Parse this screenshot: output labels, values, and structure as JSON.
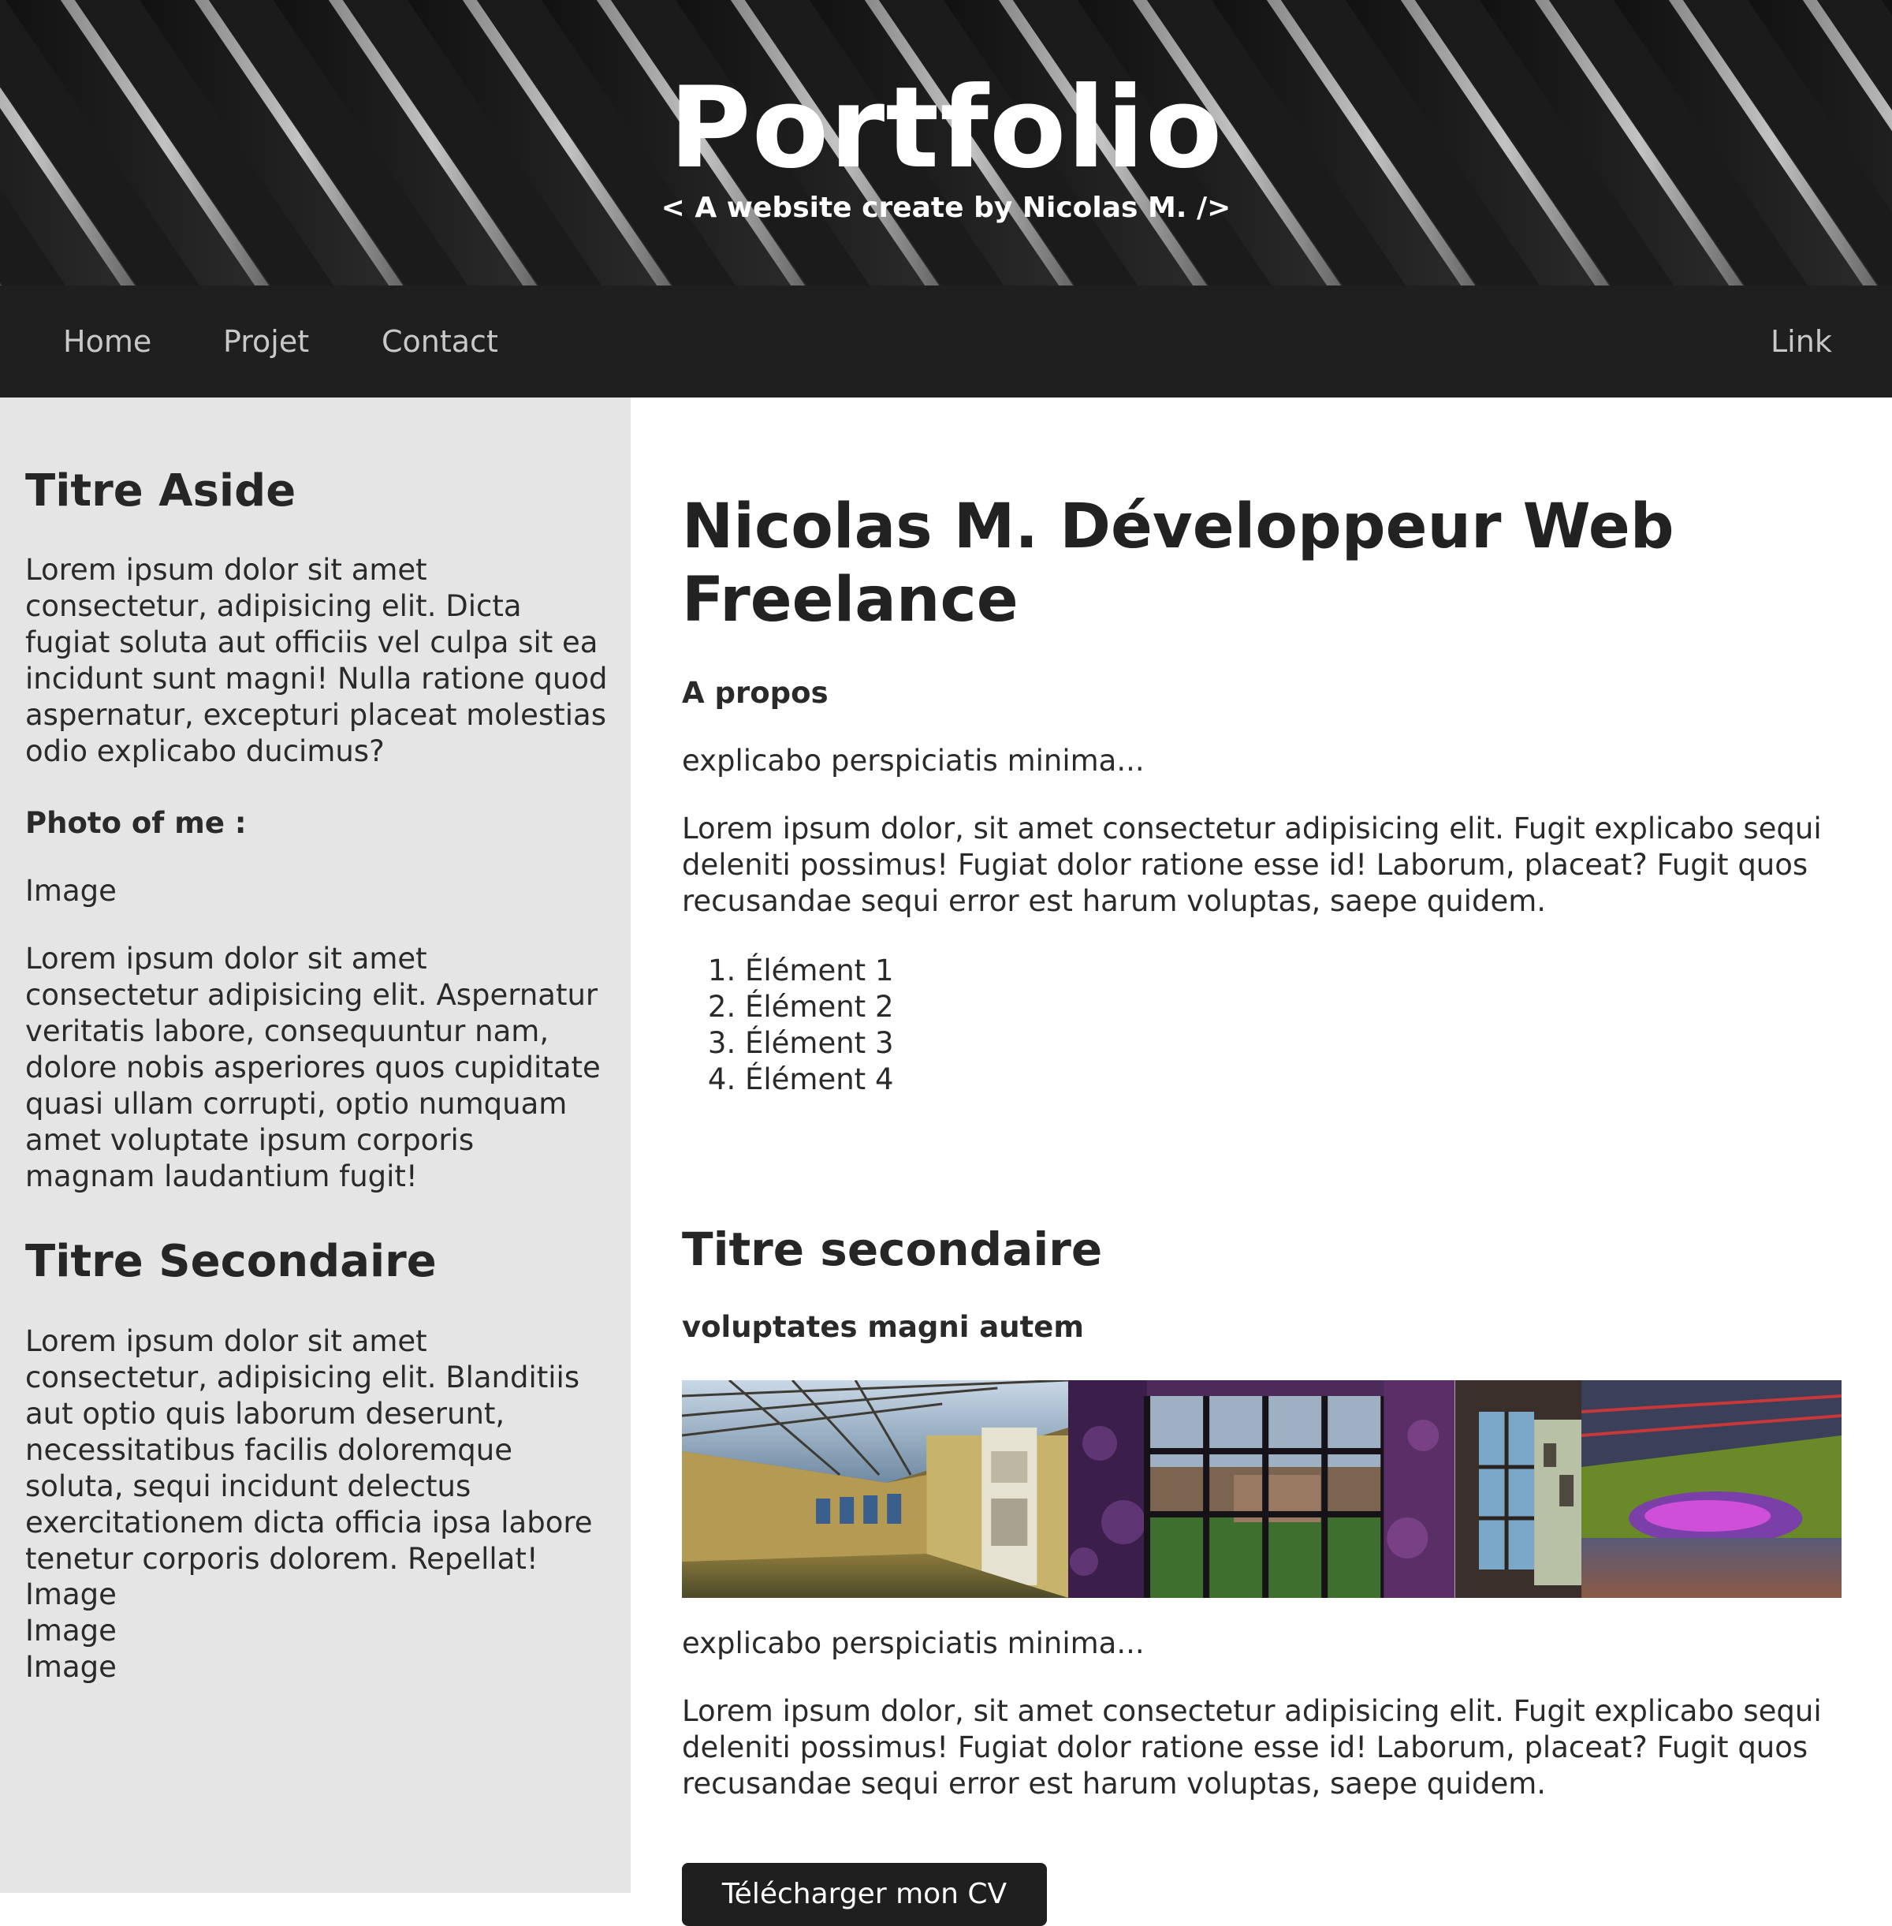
{
  "header": {
    "title": "Portfolio",
    "subtitle": "< A website create by Nicolas M. />"
  },
  "nav": {
    "items": [
      {
        "label": "Home"
      },
      {
        "label": "Projet"
      },
      {
        "label": "Contact"
      }
    ],
    "right_link": "Link"
  },
  "aside": {
    "title1": "Titre Aside",
    "para1": "Lorem ipsum dolor sit amet consectetur, adipisicing elit. Dicta fugiat soluta aut officiis vel culpa sit ea incidunt sunt magni! Nulla ratione quod aspernatur, excepturi placeat molestias odio explicabo ducimus?",
    "photo_label": "Photo of me :",
    "image_label": "Image",
    "para2": "Lorem ipsum dolor sit amet consectetur adipisicing elit. Aspernatur veritatis labore, consequuntur nam, dolore nobis asperiores quos cupiditate quasi ullam corrupti, optio numquam amet voluptate ipsum corporis magnam laudantium fugit!",
    "title2": "Titre Secondaire",
    "para3": "Lorem ipsum dolor sit amet consectetur, adipisicing elit. Blanditiis aut optio quis laborum deserunt, necessitatibus facilis doloremque soluta, sequi incidunt delectus exercitationem dicta officia ipsa labore tenetur corporis dolorem. Repellat!",
    "images": [
      "Image",
      "Image",
      "Image"
    ]
  },
  "main": {
    "title": "Nicolas M. Développeur Web Freelance",
    "about_heading": "A propos",
    "intro": "explicabo perspiciatis minima...",
    "paragraph": "Lorem ipsum dolor, sit amet consectetur adipisicing elit. Fugit explicabo sequi deleniti possimus! Fugiat dolor ratione esse id! Laborum, placeat? Fugit quos recusandae sequi error est harum voluptas, saepe quidem.",
    "list": [
      "Élément 1",
      "Élément 2",
      "Élément 3",
      "Élément 4"
    ],
    "secondary_title": "Titre secondaire",
    "secondary_subheading": "voluptates magni autem",
    "secondary_intro": "explicabo perspiciatis minima...",
    "secondary_paragraph": "Lorem ipsum dolor, sit amet consectetur adipisicing elit. Fugit explicabo sequi deleniti possimus! Fugiat dolor ratione esse id! Laborum, placeat? Fugit quos recusandae sequi error est harum voluptas, saepe quidem.",
    "cv_button": "Télécharger mon CV"
  },
  "colors": {
    "header_bg": "#1c1c1c",
    "nav_bg": "#1f1f1f",
    "nav_text": "#c8c8c8",
    "aside_bg": "#e5e5e5",
    "text": "#262626",
    "button_bg": "#1f1f1f"
  }
}
